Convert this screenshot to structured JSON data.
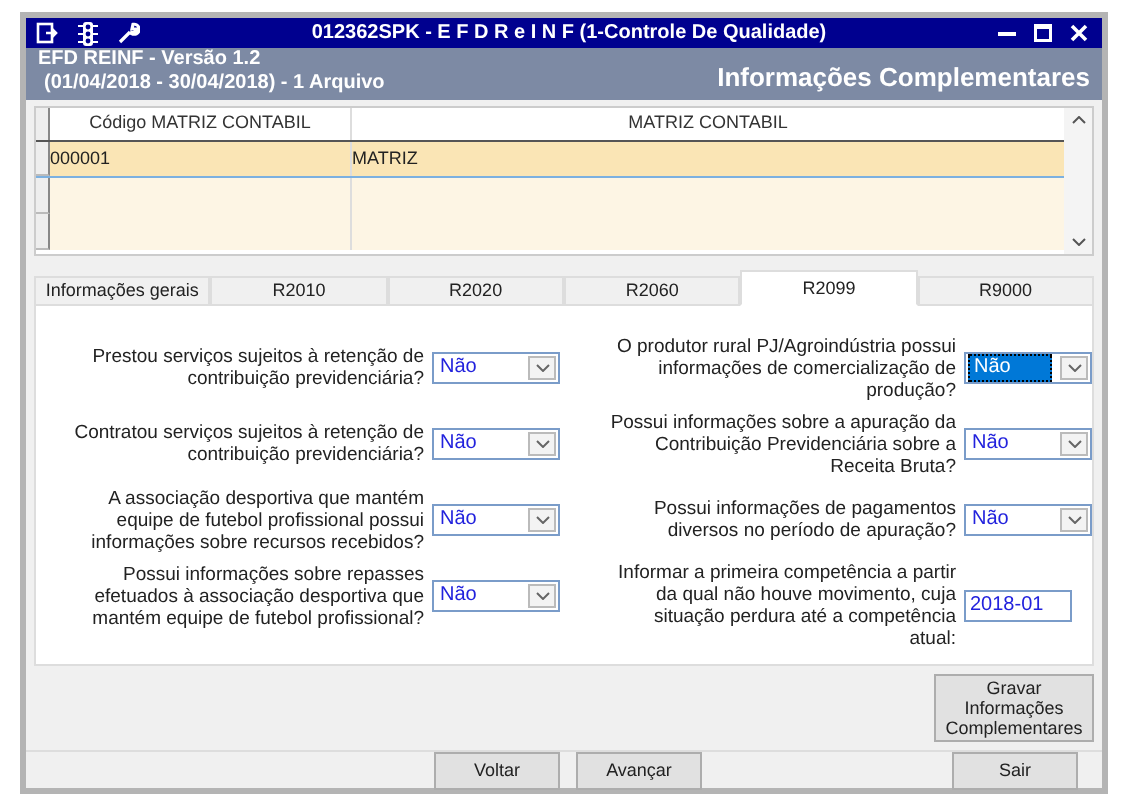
{
  "window": {
    "title": "012362SPK - E F D  R e I N F (1-Controle De Qualidade)"
  },
  "header": {
    "version": "EFD REINF - Versão 1.2",
    "period": "(01/04/2018 - 30/04/2018) - 1 Arquivo",
    "section": "Informações Complementares"
  },
  "grid": {
    "columns": [
      "Código MATRIZ CONTABIL",
      "MATRIZ CONTABIL"
    ],
    "rows": [
      {
        "cells": [
          "000001",
          "MATRIZ"
        ],
        "selected": true
      },
      {
        "cells": [],
        "selected": false
      },
      {
        "cells": [],
        "selected": false
      }
    ]
  },
  "tabs": [
    {
      "label": "Informações gerais",
      "selected": false
    },
    {
      "label": "R2010",
      "selected": false
    },
    {
      "label": "R2020",
      "selected": false
    },
    {
      "label": "R2060",
      "selected": false
    },
    {
      "label": "R2099",
      "selected": true
    },
    {
      "label": "R9000",
      "selected": false
    }
  ],
  "left_fields": [
    {
      "kind": "select",
      "label": "Prestou serviços sujeitos à retenção de contribuição previdenciária?",
      "value": "Não",
      "focused": false
    },
    {
      "kind": "select",
      "label": "Contratou serviços sujeitos à retenção de contribuição previdenciária?",
      "value": "Não",
      "focused": false
    },
    {
      "kind": "select",
      "label": "A associação desportiva que mantém equipe de futebol profissional possui informações sobre recursos recebidos?",
      "value": "Não",
      "focused": false
    },
    {
      "kind": "select",
      "label": "Possui informações sobre repasses efetuados à associação desportiva que mantém equipe de futebol profissional?",
      "value": "Não",
      "focused": false
    }
  ],
  "right_fields": [
    {
      "kind": "select",
      "label": "O produtor rural PJ/Agroindústria possui informações de comercialização de produção?",
      "value": "Não",
      "focused": true
    },
    {
      "kind": "select",
      "label": "Possui informações sobre a apuração da Contribuição Previdenciária sobre a Receita Bruta?",
      "value": "Não",
      "focused": false
    },
    {
      "kind": "select",
      "label": "Possui informações de pagamentos diversos no período de apuração?",
      "value": "Não",
      "focused": false
    },
    {
      "kind": "text",
      "label": "Informar a primeira competência a partir da qual não houve movimento, cuja situação perdura até a competência atual:",
      "value": "2018-01",
      "focused": false
    }
  ],
  "save_button": {
    "lines": [
      "Gravar Informações",
      "Complementares"
    ]
  },
  "buttons": [
    {
      "label": "Voltar"
    },
    {
      "label": "Avançar"
    }
  ],
  "exit_button": {
    "label": "Sair"
  }
}
